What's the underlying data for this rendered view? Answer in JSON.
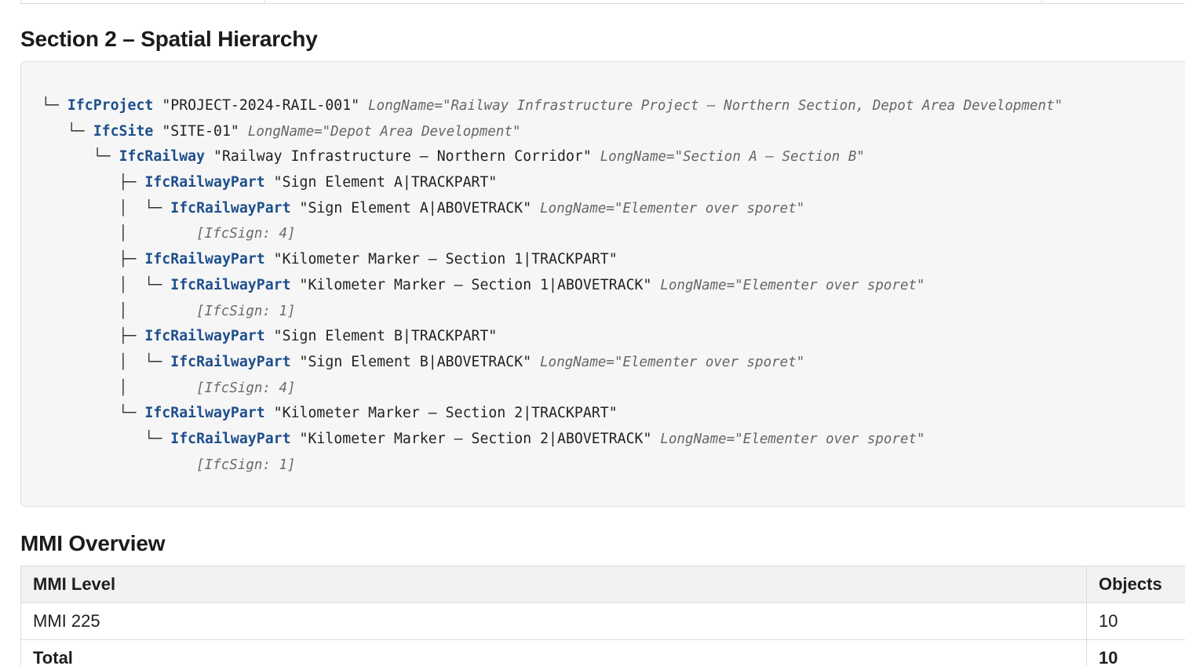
{
  "section_title": "Section 2 – Spatial Hierarchy",
  "tree": [
    {
      "guide": "└─ ",
      "type": "IfcProject",
      "name": "\"PROJECT-2024-RAIL-001\"",
      "long": "LongName=\"Railway Infrastructure Project – Northern Section, Depot Area Development\""
    },
    {
      "guide": "   └─ ",
      "type": "IfcSite",
      "name": "\"SITE-01\"",
      "long": "LongName=\"Depot Area Development\""
    },
    {
      "guide": "      └─ ",
      "type": "IfcRailway",
      "name": "\"Railway Infrastructure – Northern Corridor\"",
      "long": "LongName=\"Section A – Section B\""
    },
    {
      "guide": "         ├─ ",
      "type": "IfcRailwayPart",
      "name": "\"Sign Element A|TRACKPART\"",
      "long": ""
    },
    {
      "guide": "         │  └─ ",
      "type": "IfcRailwayPart",
      "name": "\"Sign Element A|ABOVETRACK\"",
      "long": "LongName=\"Elementer over sporet\""
    },
    {
      "guide": "         │        ",
      "type": "",
      "name": "",
      "long": "",
      "count": "[IfcSign: 4]"
    },
    {
      "guide": "         ├─ ",
      "type": "IfcRailwayPart",
      "name": "\"Kilometer Marker – Section 1|TRACKPART\"",
      "long": ""
    },
    {
      "guide": "         │  └─ ",
      "type": "IfcRailwayPart",
      "name": "\"Kilometer Marker – Section 1|ABOVETRACK\"",
      "long": "LongName=\"Elementer over sporet\""
    },
    {
      "guide": "         │        ",
      "type": "",
      "name": "",
      "long": "",
      "count": "[IfcSign: 1]"
    },
    {
      "guide": "         ├─ ",
      "type": "IfcRailwayPart",
      "name": "\"Sign Element B|TRACKPART\"",
      "long": ""
    },
    {
      "guide": "         │  └─ ",
      "type": "IfcRailwayPart",
      "name": "\"Sign Element B|ABOVETRACK\"",
      "long": "LongName=\"Elementer over sporet\""
    },
    {
      "guide": "         │        ",
      "type": "",
      "name": "",
      "long": "",
      "count": "[IfcSign: 4]"
    },
    {
      "guide": "         └─ ",
      "type": "IfcRailwayPart",
      "name": "\"Kilometer Marker – Section 2|TRACKPART\"",
      "long": ""
    },
    {
      "guide": "            └─ ",
      "type": "IfcRailwayPart",
      "name": "\"Kilometer Marker – Section 2|ABOVETRACK\"",
      "long": "LongName=\"Elementer over sporet\""
    },
    {
      "guide": "                  ",
      "type": "",
      "name": "",
      "long": "",
      "count": "[IfcSign: 1]"
    }
  ],
  "mmi_title": "MMI Overview",
  "mmi_table": {
    "headers": [
      "MMI Level",
      "Objects"
    ],
    "rows": [
      [
        "MMI 225",
        "10"
      ]
    ],
    "total": [
      "Total",
      "10"
    ]
  },
  "colors": {
    "ifc_type": "#1e4f8c",
    "code_background": "#f6f6f6",
    "longname": "#666666"
  }
}
